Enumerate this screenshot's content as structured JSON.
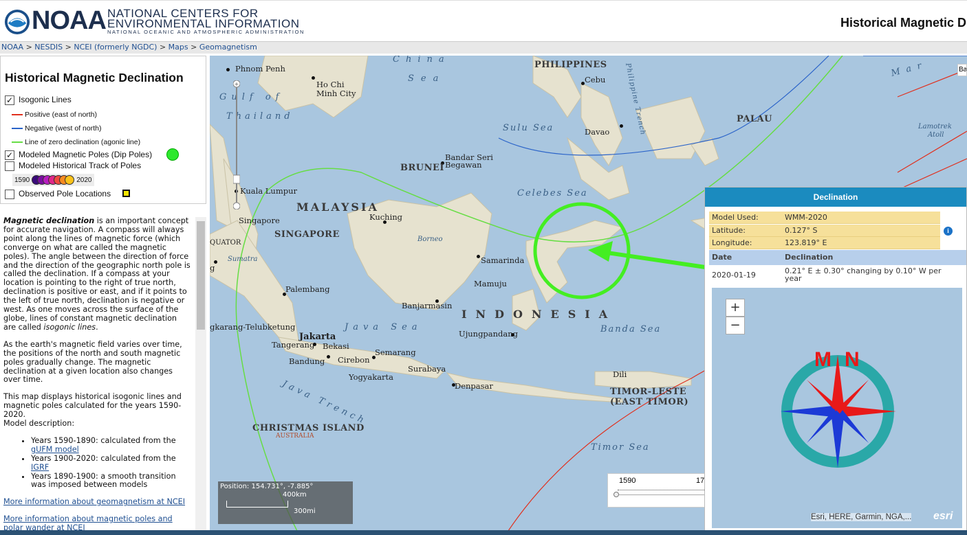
{
  "header": {
    "noaa": "NOAA",
    "ncei_line1": "NATIONAL CENTERS FOR",
    "ncei_line2": "ENVIRONMENTAL INFORMATION",
    "ncei_line3": "NATIONAL OCEANIC AND ATMOSPHERIC ADMINISTRATION",
    "page_title": "Historical Magnetic D"
  },
  "breadcrumb": [
    "NOAA",
    "NESDIS",
    "NCEI (formerly NGDC)",
    "Maps",
    "Geomagnetism"
  ],
  "breadcrumb_sep": ">",
  "legend": {
    "title": "Historical Magnetic Declination",
    "isogonic": "Isogonic Lines",
    "positive": "Positive (east of north)",
    "negative": "Negative (west of north)",
    "zero": "Line of zero declination (agonic line)",
    "poles": "Modeled Magnetic Poles (Dip Poles)",
    "track": "Modeled Historical Track of Poles",
    "track_start": "1590",
    "track_end": "2020",
    "observed": "Observed Pole Locations",
    "colors": {
      "positive": "#e0301e",
      "negative": "#2a63c9",
      "zero": "#66dd44",
      "pole": "#2ee82e"
    }
  },
  "desc": {
    "p1_term": "Magnetic declination",
    "p1": " is an important concept for accurate navigation. A compass will always point along the lines of magnetic force (which converge on what are called the magnetic poles). The angle between the direction of force and the direction of the geographic north pole is called the declination. If a compass at your location is pointing to the right of true north, declination is positive or east, and if it points to the left of true north, declination is negative or west. As one moves across the surface of the globe, lines of constant magnetic declination are called ",
    "p1_term2": "isogonic lines",
    "p1_end": ".",
    "p2": "As the earth's magnetic field varies over time, the positions of the north and south magnetic poles gradually change. The magnetic declination at a given location also changes over time.",
    "p3": "This map displays historical isogonic lines and magnetic poles calculated for the years 1590-2020.",
    "p3b": "Model description:",
    "li1": "Years 1590-1890: calculated from the ",
    "li1_link": "gUFM model",
    "li2": "Years 1900-2020: calculated from the ",
    "li2_link": "IGRF",
    "li3": "Years 1890-1900: a smooth transition was imposed between models",
    "link1": "More information about geomagnetism at NCEI",
    "link2": "More information about magnetic poles and polar wander at NCEI"
  },
  "map": {
    "labels": {
      "phnom_penh": "Phnom Penh",
      "ho_chi": "Ho Chi",
      "minh_city": "Minh City",
      "china": "China",
      "sea": "Sea",
      "philippines": "PHILIPPINES",
      "cebu": "Cebu",
      "philippine_trench": "Philippine Trench",
      "gulf_of": "Gulf of",
      "thailand": "Thailand",
      "sulu_sea": "Sulu Sea",
      "davao": "Davao",
      "palau": "PALAU",
      "lamotrek": "Lamotrek",
      "atoll": "Atoll",
      "mar": "Mar",
      "bandar1": "Bandar Seri",
      "bandar2": "Begawan",
      "brunei": "BRUNEI",
      "celebes": "Celebes Sea",
      "kuala": "Kuala Lumpur",
      "malaysia": "MALAYSIA",
      "kuching": "Kuching",
      "singapore_city": "Singapore",
      "singapore": "SINGAPORE",
      "borneo": "Borneo",
      "equator": "QUATOR",
      "sumatra": "Sumatra",
      "samarinda": "Samarinda",
      "mamuju": "Mamuju",
      "palembang": "Palembang",
      "banjarmasin": "Banjarmasin",
      "indonesia": "INDONESIA",
      "java_sea": "Java Sea",
      "banda_sea": "Banda Sea",
      "bandar_lampung": "gkarang-Telubketung",
      "jakarta": "Jakarta",
      "tangerang": "Tangerang",
      "bekasi": "Bekasi",
      "ujungpandang": "Ujungpandang",
      "semarang": "Semarang",
      "bandung": "Bandung",
      "cirebon": "Cirebon",
      "surabaya": "Surabaya",
      "yogyakarta": "Yogyakarta",
      "dili": "Dili",
      "denpasar": "Denpasar",
      "timor_leste": "TIMOR-LESTE",
      "east_timor": "(EAST TIMOR)",
      "java_trench": "Java Trench",
      "christmas": "CHRISTMAS ISLAND",
      "australia": "AUSTRALIA",
      "timor_sea": "Timor Sea",
      "g_edge": "g"
    },
    "position": "Position: 154.731°, -7.885°",
    "scale_km": "400km",
    "scale_mi": "300mi",
    "year_slider": {
      "start": "1590",
      "next": "17"
    },
    "basemap": "Ba"
  },
  "popup": {
    "title": "Declination",
    "model_label": "Model Used:",
    "model": "WMM-2020",
    "lat_label": "Latitude:",
    "lat": "0.127° S",
    "lon_label": "Longitude:",
    "lon": "123.819° E",
    "col_date": "Date",
    "col_decl": "Declination",
    "date": "2020-01-19",
    "decl": "0.21° E  ± 0.30°  changing by  0.10° W per year",
    "info": "i",
    "zoom_in": "+",
    "zoom_out": "−",
    "compass_m": "M",
    "compass_n": "N",
    "attribution": "Esri, HERE, Garmin, NGA,...",
    "esri": "esri"
  }
}
